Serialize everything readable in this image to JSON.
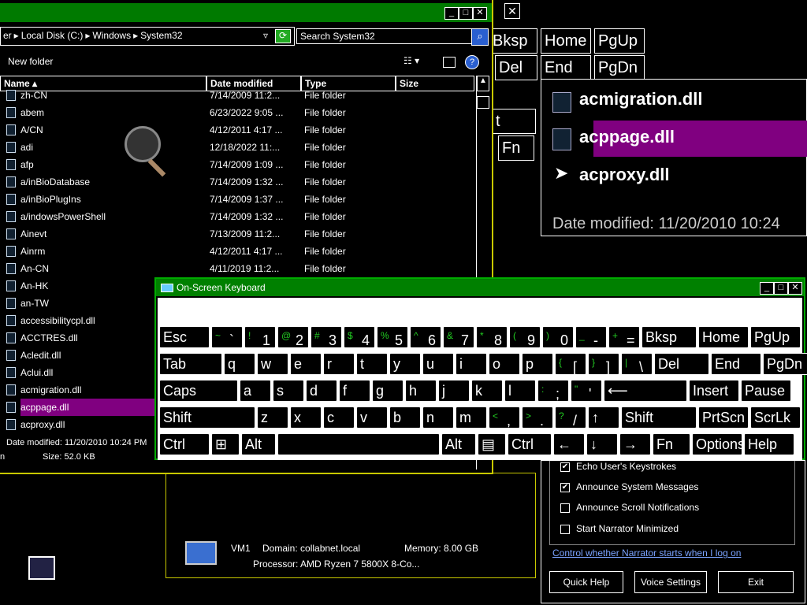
{
  "explorer": {
    "breadcrumb": [
      "er",
      "Local Disk (C:)",
      "Windows",
      "System32"
    ],
    "search_placeholder": "Search System32",
    "new_folder": "New folder",
    "columns": [
      "Name",
      "Date modified",
      "Type",
      "Size"
    ],
    "rows": [
      {
        "name": "zh-CN",
        "date": "7/14/2009 11:2...",
        "type": "File folder"
      },
      {
        "name": "abem",
        "date": "6/23/2022 9:05 ...",
        "type": "File folder"
      },
      {
        "name": "A/CN",
        "date": "4/12/2011 4:17 ...",
        "type": "File folder"
      },
      {
        "name": "adi",
        "date": "12/18/2022 11:...",
        "type": "File folder"
      },
      {
        "name": "afp",
        "date": "7/14/2009 1:09 ...",
        "type": "File folder"
      },
      {
        "name": "a/inBioDatabase",
        "date": "7/14/2009 1:32 ...",
        "type": "File folder"
      },
      {
        "name": "a/inBioPlugIns",
        "date": "7/14/2009 1:37 ...",
        "type": "File folder"
      },
      {
        "name": "a/indowsPowerShell",
        "date": "7/14/2009 1:32 ...",
        "type": "File folder"
      },
      {
        "name": "Ainevt",
        "date": "7/13/2009 11:2...",
        "type": "File folder"
      },
      {
        "name": "Ainrm",
        "date": "4/12/2011 4:17 ...",
        "type": "File folder"
      },
      {
        "name": "An-CN",
        "date": "4/11/2019 11:2...",
        "type": "File folder"
      },
      {
        "name": "An-HK",
        "date": "",
        "type": ""
      },
      {
        "name": "an-TW",
        "date": "",
        "type": ""
      },
      {
        "name": "accessibilitycpl.dll",
        "date": "",
        "type": ""
      },
      {
        "name": "ACCTRES.dll",
        "date": "",
        "type": ""
      },
      {
        "name": "Acledit.dll",
        "date": "",
        "type": ""
      },
      {
        "name": "Aclui.dll",
        "date": "",
        "type": ""
      },
      {
        "name": "acmigration.dll",
        "date": "",
        "type": ""
      },
      {
        "name": "acppage.dll",
        "date": "",
        "type": ""
      },
      {
        "name": "acproxy.dll",
        "date": "",
        "type": ""
      }
    ],
    "status_date": "Date modified: 11/20/2010 10:24 PM",
    "status_size_label": "n",
    "status_size": "Size: 52.0 KB"
  },
  "osk": {
    "title": "On-Screen Keyboard",
    "row1": [
      {
        "mn": "Esc"
      },
      {
        "sm": "~",
        "mn": "`"
      },
      {
        "sm": "!",
        "mn": "1"
      },
      {
        "sm": "@",
        "mn": "2"
      },
      {
        "sm": "#",
        "mn": "3"
      },
      {
        "sm": "$",
        "mn": "4"
      },
      {
        "sm": "%",
        "mn": "5"
      },
      {
        "sm": "^",
        "mn": "6"
      },
      {
        "sm": "&",
        "mn": "7"
      },
      {
        "sm": "*",
        "mn": "8"
      },
      {
        "sm": "(",
        "mn": "9"
      },
      {
        "sm": ")",
        "mn": "0"
      },
      {
        "sm": "_",
        "mn": "-"
      },
      {
        "sm": "+",
        "mn": "="
      },
      {
        "mn": "Bksp"
      },
      {
        "mn": "Home"
      },
      {
        "mn": "PgUp"
      }
    ],
    "row2": [
      {
        "mn": "Tab"
      },
      {
        "mn": "q"
      },
      {
        "mn": "w"
      },
      {
        "mn": "e"
      },
      {
        "mn": "r"
      },
      {
        "mn": "t"
      },
      {
        "mn": "y"
      },
      {
        "mn": "u"
      },
      {
        "mn": "i"
      },
      {
        "mn": "o"
      },
      {
        "mn": "p"
      },
      {
        "sm": "{",
        "mn": "["
      },
      {
        "sm": "}",
        "mn": "]"
      },
      {
        "sm": "|",
        "mn": "\\"
      },
      {
        "mn": "Del"
      },
      {
        "mn": "End"
      },
      {
        "mn": "PgDn"
      }
    ],
    "row3": [
      {
        "mn": "Caps"
      },
      {
        "mn": "a"
      },
      {
        "mn": "s"
      },
      {
        "mn": "d"
      },
      {
        "mn": "f"
      },
      {
        "mn": "g"
      },
      {
        "mn": "h"
      },
      {
        "mn": "j"
      },
      {
        "mn": "k"
      },
      {
        "mn": "l"
      },
      {
        "sm": ":",
        "mn": ";"
      },
      {
        "sm": "\"",
        "mn": "'"
      },
      {
        "mn": "⟵"
      },
      {
        "mn": "Insert"
      },
      {
        "mn": "Pause"
      }
    ],
    "row4": [
      {
        "mn": "Shift"
      },
      {
        "mn": "z"
      },
      {
        "mn": "x"
      },
      {
        "mn": "c"
      },
      {
        "mn": "v"
      },
      {
        "mn": "b"
      },
      {
        "mn": "n"
      },
      {
        "mn": "m"
      },
      {
        "sm": "<",
        "mn": ","
      },
      {
        "sm": ">",
        "mn": "."
      },
      {
        "sm": "?",
        "mn": "/"
      },
      {
        "mn": "↑"
      },
      {
        "mn": "Shift"
      },
      {
        "mn": "PrtScn"
      },
      {
        "mn": "ScrLk"
      }
    ],
    "row5": [
      {
        "mn": "Ctrl"
      },
      {
        "mn": "⊞"
      },
      {
        "mn": "Alt"
      },
      {
        "mn": ""
      },
      {
        "mn": "Alt"
      },
      {
        "mn": "▤"
      },
      {
        "mn": "Ctrl"
      },
      {
        "mn": "←"
      },
      {
        "mn": "↓"
      },
      {
        "mn": "→"
      },
      {
        "mn": "Fn"
      },
      {
        "mn": "Options"
      },
      {
        "mn": "Help"
      }
    ]
  },
  "bg_keys": {
    "bksp": "Bksp",
    "home": "Home",
    "pgup": "PgUp",
    "del": "Del",
    "end": "End",
    "pgdn": "PgDn",
    "t": "t",
    "fn": "Fn"
  },
  "zoom": {
    "items": [
      "acmigration.dll",
      "acppage.dll",
      "acproxy.dll"
    ],
    "date": "Date modified: 11/20/2010 10:24"
  },
  "narrator": {
    "options": [
      {
        "label": "Echo User's Keystrokes",
        "checked": "✔"
      },
      {
        "label": "Announce System Messages",
        "checked": "✔"
      },
      {
        "label": "Announce Scroll Notifications",
        "checked": ""
      },
      {
        "label": "Start Narrator Minimized",
        "checked": ""
      }
    ],
    "link": "Control whether Narrator starts when I log on",
    "buttons": [
      "Quick Help",
      "Voice Settings",
      "Exit"
    ]
  },
  "vm": {
    "name": "VM1",
    "domain": "Domain: collabnet.local",
    "memory": "Memory: 8.00 GB",
    "processor": "Processor: AMD Ryzen 7 5800X 8-Co..."
  }
}
